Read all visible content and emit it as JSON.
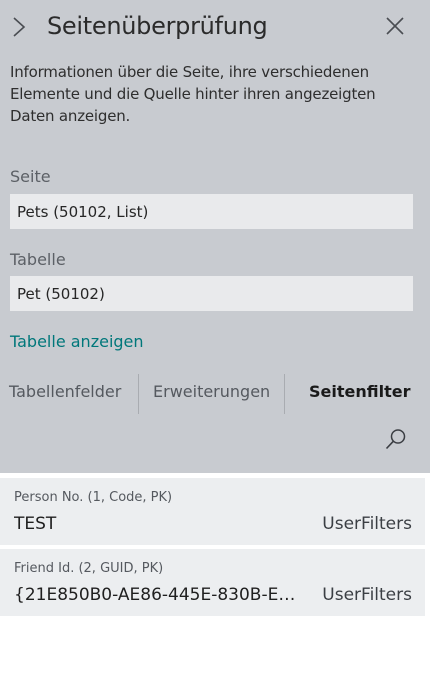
{
  "header": {
    "title": "Seitenüberprüfung",
    "icons": {
      "expand": "chevron-right-icon",
      "close": "close-icon"
    }
  },
  "description": "Informationen über die Seite, ihre verschiedenen Elemente und die Quelle hinter ihren angezeigten Daten anzeigen.",
  "page_field": {
    "label": "Seite",
    "value": "Pets (50102, List)"
  },
  "table_field": {
    "label": "Tabelle",
    "value": "Pet (50102)"
  },
  "view_table_link": "Tabelle anzeigen",
  "tabs": [
    {
      "label": "Tabellenfelder",
      "active": false
    },
    {
      "label": "Erweiterungen",
      "active": false
    },
    {
      "label": "Seitenfilter",
      "active": true
    }
  ],
  "search_icon": "search-icon",
  "filters": [
    {
      "label": "Person No. (1, Code, PK)",
      "value": "TEST",
      "source": "UserFilters"
    },
    {
      "label": "Friend Id. (2, GUID, PK)",
      "value": "{21E850B0-AE86-445E-830B-E6…",
      "source": "UserFilters"
    }
  ],
  "colors": {
    "panel_bg": "#c8cbd0",
    "field_bg": "#e9eaec",
    "card_bg": "#eceef0",
    "link": "#00777a"
  }
}
